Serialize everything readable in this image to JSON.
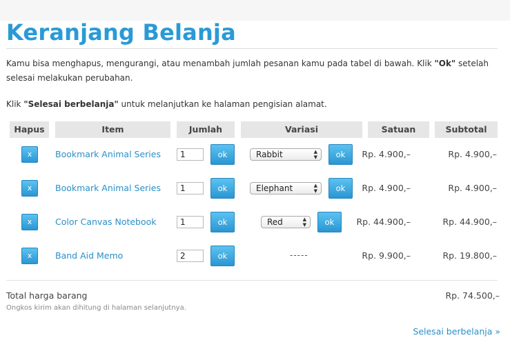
{
  "page": {
    "title": "Keranjang Belanja",
    "intro_text_1": "Kamu bisa menghapus, mengurangi, atau menambah jumlah pesanan kamu pada tabel di bawah. Klik ",
    "intro_bold_1": "\"Ok\"",
    "intro_text_2": " setelah selesai melakukan perubahan.",
    "intro2_text_1": "Klik ",
    "intro2_bold": "\"Selesai berbelanja\"",
    "intro2_text_2": " untuk melanjutkan ke halaman pengisian alamat."
  },
  "table": {
    "headers": {
      "hapus": "Hapus",
      "item": "Item",
      "jumlah": "Jumlah",
      "variasi": "Variasi",
      "satuan": "Satuan",
      "subtotal": "Subtotal"
    },
    "delete_label": "x",
    "ok_label": "ok",
    "rows": [
      {
        "item": "Bookmark Animal Series",
        "qty": "1",
        "variant": "Rabbit",
        "unit_price": "Rp. 4.900,–",
        "subtotal": "Rp. 4.900,–"
      },
      {
        "item": "Bookmark Animal Series",
        "qty": "1",
        "variant": "Elephant",
        "unit_price": "Rp. 4.900,–",
        "subtotal": "Rp. 4.900,–"
      },
      {
        "item": "Color Canvas Notebook",
        "qty": "1",
        "variant": "Red",
        "unit_price": "Rp. 44.900,–",
        "subtotal": "Rp. 44.900,–"
      },
      {
        "item": "Band Aid Memo",
        "qty": "2",
        "variant": "-----",
        "unit_price": "Rp. 9.900,–",
        "subtotal": "Rp. 19.800,–"
      }
    ]
  },
  "summary": {
    "total_label": "Total harga barang",
    "total_value": "Rp. 74.500,–",
    "shipping_note": "Ongkos kirim akan dihitung di halaman selanjutnya."
  },
  "actions": {
    "finish_label": "Selesai berbelanja »"
  },
  "colors": {
    "accent": "#2a9ad6",
    "button": "#3aa6df"
  }
}
